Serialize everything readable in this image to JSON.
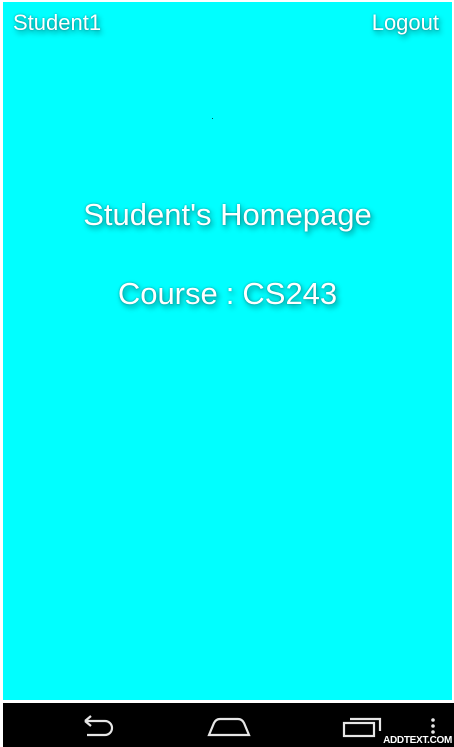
{
  "header": {
    "username": "Student1",
    "logout_label": "Logout"
  },
  "main": {
    "title": "Student's Homepage",
    "course_label": "Course",
    "course_separator": ":",
    "course_code": "CS243"
  },
  "navbar": {
    "icons": [
      "back-icon",
      "home-icon",
      "recents-icon",
      "menu-icon"
    ]
  },
  "watermark": "ADDTEXT.COM",
  "colors": {
    "background": "#00ffff",
    "text": "#ffffff",
    "navbar": "#000000"
  }
}
